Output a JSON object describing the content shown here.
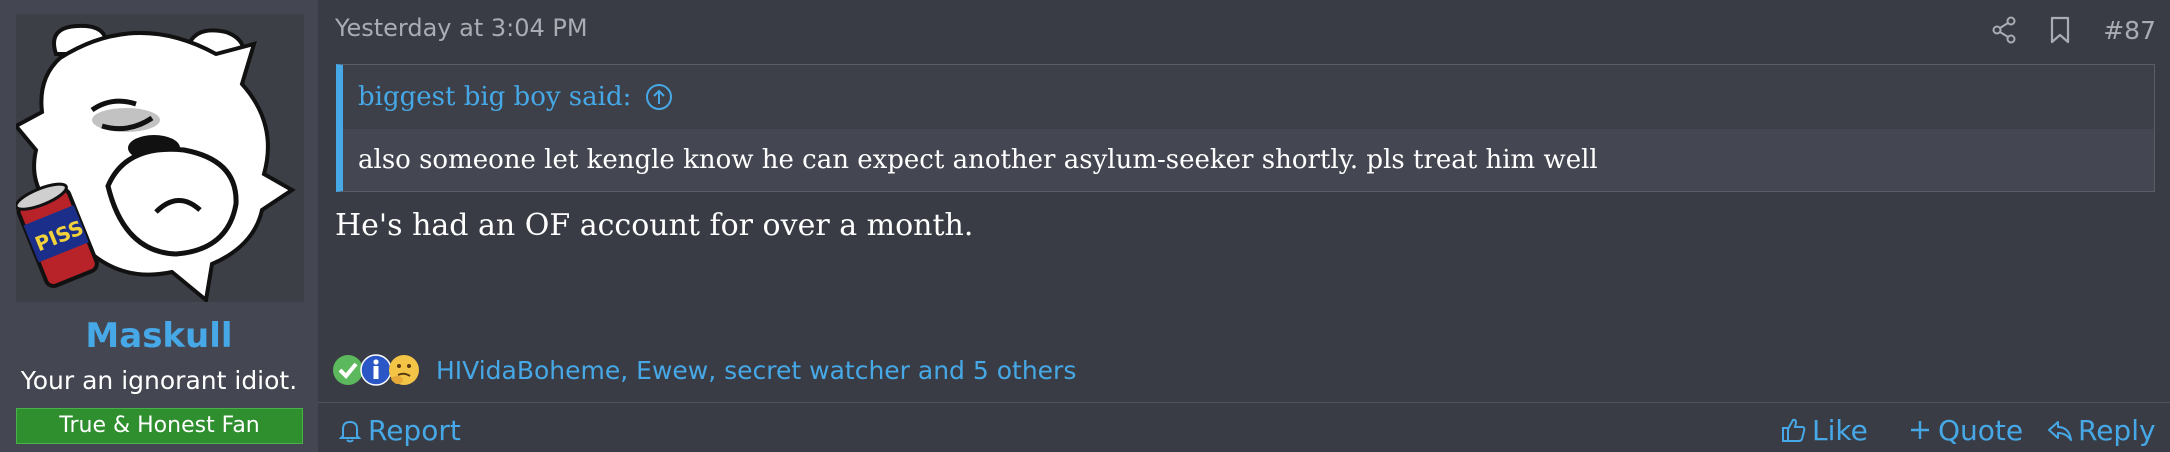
{
  "user": {
    "avatar_icon": "cartoon-bear-avatar",
    "avatar_can_text": "PISS",
    "username": "Maskull",
    "title": "Your an ignorant idiot.",
    "banner": "True & Honest Fan"
  },
  "post": {
    "date": "Yesterday at 3:04 PM",
    "number": "#87",
    "share_icon": "share-icon",
    "bookmark_icon": "bookmark-icon"
  },
  "quote": {
    "author": "biggest big boy said:",
    "text": "also someone let kengle know he can expect another asylum-seeker shortly. pls treat him well"
  },
  "message": "He's had an OF account for over a month.",
  "reactions": {
    "icons": [
      "check-icon",
      "info-icon",
      "thinking-face-icon"
    ],
    "users": "HIVidaBoheme, Ewew, secret watcher and 5 others"
  },
  "actions": {
    "report": "Report",
    "like": "Like",
    "quote": "Quote",
    "reply": "Reply"
  },
  "colors": {
    "background": "#393c44",
    "sidebar": "#444751",
    "accent": "#46a8e6",
    "banner": "#2f8f2f"
  }
}
